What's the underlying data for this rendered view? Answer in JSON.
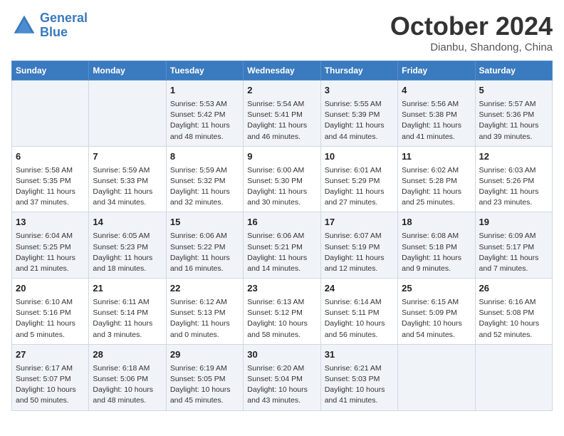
{
  "header": {
    "logo_line1": "General",
    "logo_line2": "Blue",
    "month": "October 2024",
    "location": "Dianbu, Shandong, China"
  },
  "weekdays": [
    "Sunday",
    "Monday",
    "Tuesday",
    "Wednesday",
    "Thursday",
    "Friday",
    "Saturday"
  ],
  "weeks": [
    [
      {
        "day": "",
        "info": ""
      },
      {
        "day": "",
        "info": ""
      },
      {
        "day": "1",
        "info": "Sunrise: 5:53 AM\nSunset: 5:42 PM\nDaylight: 11 hours and 48 minutes."
      },
      {
        "day": "2",
        "info": "Sunrise: 5:54 AM\nSunset: 5:41 PM\nDaylight: 11 hours and 46 minutes."
      },
      {
        "day": "3",
        "info": "Sunrise: 5:55 AM\nSunset: 5:39 PM\nDaylight: 11 hours and 44 minutes."
      },
      {
        "day": "4",
        "info": "Sunrise: 5:56 AM\nSunset: 5:38 PM\nDaylight: 11 hours and 41 minutes."
      },
      {
        "day": "5",
        "info": "Sunrise: 5:57 AM\nSunset: 5:36 PM\nDaylight: 11 hours and 39 minutes."
      }
    ],
    [
      {
        "day": "6",
        "info": "Sunrise: 5:58 AM\nSunset: 5:35 PM\nDaylight: 11 hours and 37 minutes."
      },
      {
        "day": "7",
        "info": "Sunrise: 5:59 AM\nSunset: 5:33 PM\nDaylight: 11 hours and 34 minutes."
      },
      {
        "day": "8",
        "info": "Sunrise: 5:59 AM\nSunset: 5:32 PM\nDaylight: 11 hours and 32 minutes."
      },
      {
        "day": "9",
        "info": "Sunrise: 6:00 AM\nSunset: 5:30 PM\nDaylight: 11 hours and 30 minutes."
      },
      {
        "day": "10",
        "info": "Sunrise: 6:01 AM\nSunset: 5:29 PM\nDaylight: 11 hours and 27 minutes."
      },
      {
        "day": "11",
        "info": "Sunrise: 6:02 AM\nSunset: 5:28 PM\nDaylight: 11 hours and 25 minutes."
      },
      {
        "day": "12",
        "info": "Sunrise: 6:03 AM\nSunset: 5:26 PM\nDaylight: 11 hours and 23 minutes."
      }
    ],
    [
      {
        "day": "13",
        "info": "Sunrise: 6:04 AM\nSunset: 5:25 PM\nDaylight: 11 hours and 21 minutes."
      },
      {
        "day": "14",
        "info": "Sunrise: 6:05 AM\nSunset: 5:23 PM\nDaylight: 11 hours and 18 minutes."
      },
      {
        "day": "15",
        "info": "Sunrise: 6:06 AM\nSunset: 5:22 PM\nDaylight: 11 hours and 16 minutes."
      },
      {
        "day": "16",
        "info": "Sunrise: 6:06 AM\nSunset: 5:21 PM\nDaylight: 11 hours and 14 minutes."
      },
      {
        "day": "17",
        "info": "Sunrise: 6:07 AM\nSunset: 5:19 PM\nDaylight: 11 hours and 12 minutes."
      },
      {
        "day": "18",
        "info": "Sunrise: 6:08 AM\nSunset: 5:18 PM\nDaylight: 11 hours and 9 minutes."
      },
      {
        "day": "19",
        "info": "Sunrise: 6:09 AM\nSunset: 5:17 PM\nDaylight: 11 hours and 7 minutes."
      }
    ],
    [
      {
        "day": "20",
        "info": "Sunrise: 6:10 AM\nSunset: 5:16 PM\nDaylight: 11 hours and 5 minutes."
      },
      {
        "day": "21",
        "info": "Sunrise: 6:11 AM\nSunset: 5:14 PM\nDaylight: 11 hours and 3 minutes."
      },
      {
        "day": "22",
        "info": "Sunrise: 6:12 AM\nSunset: 5:13 PM\nDaylight: 11 hours and 0 minutes."
      },
      {
        "day": "23",
        "info": "Sunrise: 6:13 AM\nSunset: 5:12 PM\nDaylight: 10 hours and 58 minutes."
      },
      {
        "day": "24",
        "info": "Sunrise: 6:14 AM\nSunset: 5:11 PM\nDaylight: 10 hours and 56 minutes."
      },
      {
        "day": "25",
        "info": "Sunrise: 6:15 AM\nSunset: 5:09 PM\nDaylight: 10 hours and 54 minutes."
      },
      {
        "day": "26",
        "info": "Sunrise: 6:16 AM\nSunset: 5:08 PM\nDaylight: 10 hours and 52 minutes."
      }
    ],
    [
      {
        "day": "27",
        "info": "Sunrise: 6:17 AM\nSunset: 5:07 PM\nDaylight: 10 hours and 50 minutes."
      },
      {
        "day": "28",
        "info": "Sunrise: 6:18 AM\nSunset: 5:06 PM\nDaylight: 10 hours and 48 minutes."
      },
      {
        "day": "29",
        "info": "Sunrise: 6:19 AM\nSunset: 5:05 PM\nDaylight: 10 hours and 45 minutes."
      },
      {
        "day": "30",
        "info": "Sunrise: 6:20 AM\nSunset: 5:04 PM\nDaylight: 10 hours and 43 minutes."
      },
      {
        "day": "31",
        "info": "Sunrise: 6:21 AM\nSunset: 5:03 PM\nDaylight: 10 hours and 41 minutes."
      },
      {
        "day": "",
        "info": ""
      },
      {
        "day": "",
        "info": ""
      }
    ]
  ]
}
